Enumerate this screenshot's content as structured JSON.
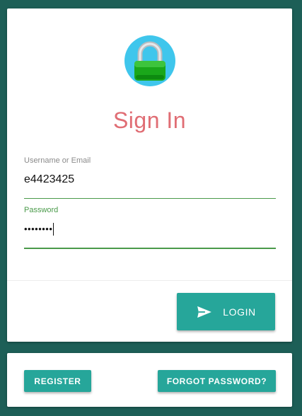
{
  "login_card": {
    "title": "Sign In",
    "logo_icon": "lock-icon",
    "username": {
      "label": "Username or Email",
      "value": "e4423425"
    },
    "password": {
      "label": "Password",
      "masked_value": "••••••••"
    },
    "login_button": {
      "label": "LOGIN",
      "icon": "send-icon"
    }
  },
  "actions_card": {
    "register_label": "REGISTER",
    "forgot_label": "FORGOT PASSWORD?"
  },
  "colors": {
    "background": "#1d5f57",
    "accent": "#26a69a",
    "title": "#e06d74",
    "field_focus": "#4a9a4a"
  }
}
